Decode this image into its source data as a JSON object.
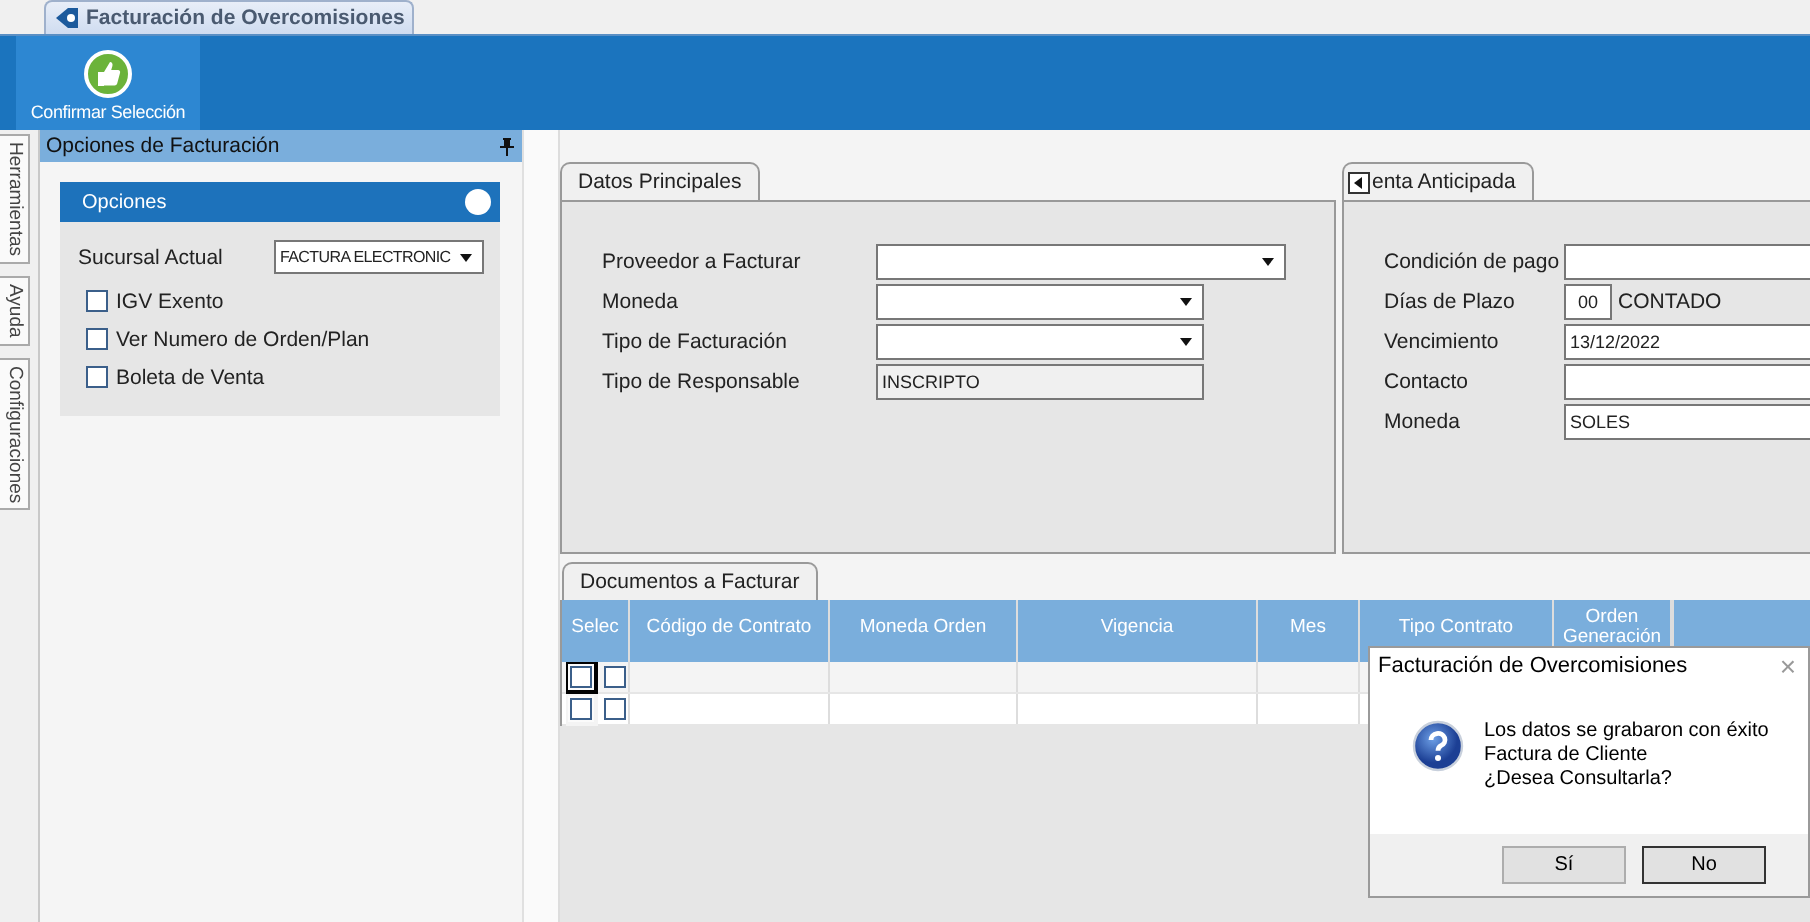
{
  "window": {
    "tab_title": "Facturación de Overcomisiones"
  },
  "toolbar": {
    "buttons": [
      {
        "label": "Confirmar Selección"
      }
    ]
  },
  "side_tabs": [
    {
      "label": "Herramientas"
    },
    {
      "label": "Ayuda"
    },
    {
      "label": "Configuraciones"
    }
  ],
  "options_panel": {
    "title": "Opciones de Facturación",
    "group_title": "Opciones",
    "branch_label": "Sucursal Actual",
    "branch_value": "FACTURA ELECTRONIC",
    "checkboxes": [
      {
        "label": "IGV Exento",
        "checked": false
      },
      {
        "label": "Ver Numero de Orden/Plan",
        "checked": false
      },
      {
        "label": "Boleta de Venta",
        "checked": false
      }
    ]
  },
  "main_data": {
    "tab": "Datos Principales",
    "fields": [
      {
        "label": "Proveedor a Facturar",
        "kind": "wide_combo"
      },
      {
        "label": "Moneda",
        "kind": "combo"
      },
      {
        "label": "Tipo de Facturación",
        "kind": "combo"
      },
      {
        "label": "Tipo de Responsable",
        "kind": "readonly",
        "value": "INSCRIPTO"
      }
    ]
  },
  "advance_sale": {
    "tab": "enta Anticipada",
    "fields": [
      {
        "label": "Condición de pago",
        "kind": "text"
      },
      {
        "label": "Días de Plazo",
        "kind": "days",
        "value": "00",
        "note": "CONTADO"
      },
      {
        "label": "Vencimiento",
        "kind": "text",
        "value": "13/12/2022"
      },
      {
        "label": "Contacto",
        "kind": "text"
      },
      {
        "label": "Moneda",
        "kind": "text",
        "value": "SOLES"
      }
    ]
  },
  "documents": {
    "tab": "Documentos a Facturar",
    "columns": [
      "Selec",
      "Código de Contrato",
      "Moneda Orden",
      "Vigencia",
      "Mes",
      "Tipo Contrato",
      "Orden Generación"
    ],
    "rows": [
      {
        "checks": [
          false,
          false
        ],
        "focused": true
      },
      {
        "checks": [
          false,
          false
        ],
        "focused": false
      }
    ]
  },
  "dialog": {
    "title": "Facturación de Overcomisiones",
    "close": "×",
    "lines": [
      "Los datos se grabaron con éxito",
      "Factura de Cliente",
      "¿Desea Consultarla?"
    ],
    "buttons": [
      "Sí",
      "No"
    ]
  }
}
